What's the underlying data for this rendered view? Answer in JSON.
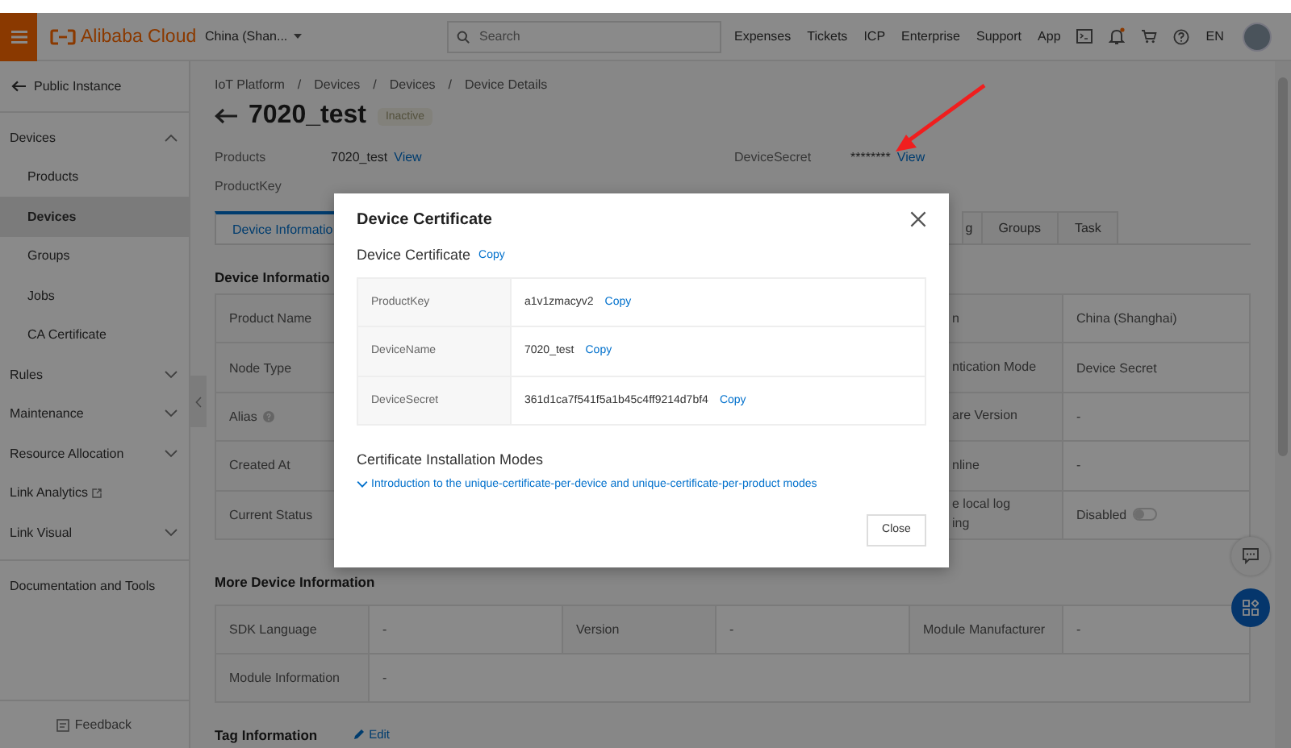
{
  "header": {
    "logo": "Alibaba Cloud",
    "region": "China (Shan...",
    "search": {
      "placeholder": "Search"
    },
    "links": [
      "Expenses",
      "Tickets",
      "ICP",
      "Enterprise",
      "Support",
      "App"
    ],
    "language": "EN"
  },
  "sidebar": {
    "back": "Public Instance",
    "items": [
      {
        "label": "Devices",
        "kind": "group",
        "expanded": true,
        "children": [
          {
            "label": "Products",
            "selected": false
          },
          {
            "label": "Devices",
            "selected": true
          },
          {
            "label": "Groups",
            "selected": false
          },
          {
            "label": "Jobs",
            "selected": false
          },
          {
            "label": "CA Certificate",
            "selected": false
          }
        ]
      },
      {
        "label": "Rules",
        "kind": "group",
        "expanded": false
      },
      {
        "label": "Maintenance",
        "kind": "group",
        "expanded": false
      },
      {
        "label": "Resource Allocation",
        "kind": "group",
        "expanded": false
      },
      {
        "label": "Link Analytics",
        "kind": "external"
      },
      {
        "label": "Link Visual",
        "kind": "group",
        "expanded": false
      },
      {
        "label": "Documentation and Tools",
        "kind": "section"
      }
    ],
    "feedback": "Feedback"
  },
  "breadcrumb": {
    "items": [
      "IoT Platform",
      "Devices",
      "Devices",
      "Device Details"
    ],
    "separator": "/"
  },
  "device": {
    "name": "7020_test",
    "status": "Inactive"
  },
  "summary": [
    {
      "label": "Products",
      "value": "7020_test",
      "link": "View"
    },
    {
      "label": "DeviceSecret",
      "value": "********",
      "link": "View"
    },
    {
      "label": "ProductKey"
    }
  ],
  "tabs": [
    {
      "label": "Device Informatio",
      "selected": true
    },
    {
      "label": "g",
      "selected": false
    },
    {
      "label": "Groups",
      "selected": false
    },
    {
      "label": "Task",
      "selected": false
    }
  ],
  "device_info": {
    "title": "Device Informatio",
    "rows": [
      {
        "kind": "text",
        "label": "Product Name",
        "label_2": "n",
        "value_2": "China (Shanghai)"
      },
      {
        "kind": "text",
        "label": "Node Type",
        "label_2": "ntication Mode",
        "value_2": "Device Secret"
      },
      {
        "kind": "text",
        "label": "Alias",
        "info": true,
        "label_2": "are Version",
        "value_2": "-"
      },
      {
        "kind": "text",
        "label": "Created At",
        "label_2": "nline",
        "value_2": "-"
      },
      {
        "kind": "toggle",
        "label": "Current Status",
        "label_2": "e local log\ning",
        "value_2": "Disabled",
        "on": false
      }
    ]
  },
  "more_info": {
    "title": "More Device Information",
    "rows": [
      [
        "SDK Language",
        "-",
        "Version",
        "-",
        "Module Manufacturer",
        "-"
      ],
      [
        "Module Information",
        "-"
      ]
    ]
  },
  "tag_info": {
    "title": "Tag Information",
    "action": "Edit"
  },
  "modal": {
    "title": "Device Certificate",
    "subtitle": "Device Certificate",
    "copy": "Copy",
    "fields": [
      {
        "label": "ProductKey",
        "value": "a1v1zmacyv2",
        "action": "Copy"
      },
      {
        "label": "DeviceName",
        "value": "7020_test",
        "action": "Copy"
      },
      {
        "label": "DeviceSecret",
        "value": "361d1ca7f541f5a1b45c4ff9214d7bf4",
        "action": "Copy"
      }
    ],
    "section": "Certificate Installation Modes",
    "link": "Introduction to the unique-certificate-per-device and unique-certificate-per-product modes",
    "button": "Close"
  }
}
